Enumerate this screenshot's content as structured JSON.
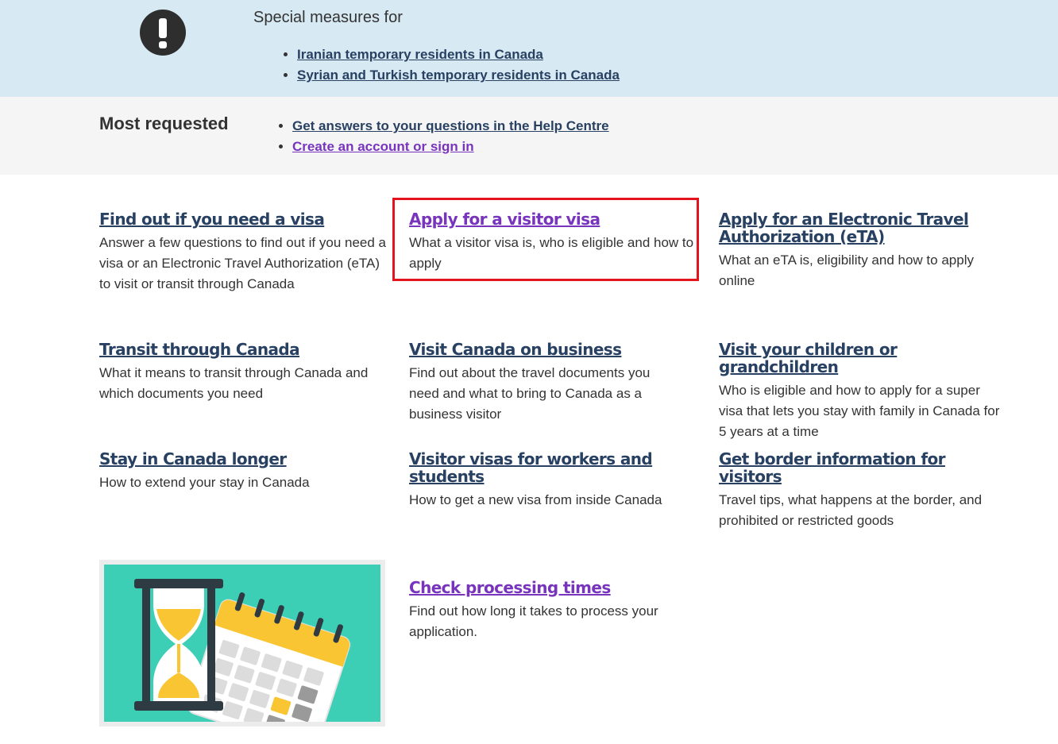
{
  "alert": {
    "title": "Special measures for",
    "links": [
      "Iranian temporary residents in Canada",
      "Syrian and Turkish temporary residents in Canada"
    ],
    "icon": "exclamation-icon"
  },
  "most_requested": {
    "title": "Most requested",
    "links": [
      "Get answers to your questions in the Help Centre",
      "Create an account or sign in"
    ]
  },
  "cards": [
    {
      "title": "Find out if you need a visa",
      "desc": "Answer a few questions to find out if you need a visa or an Electronic Travel Authorization (eTA) to visit or transit through Canada"
    },
    {
      "title": "Apply for a visitor visa",
      "desc": "What a visitor visa is, who is eligible and how to apply"
    },
    {
      "title": "Apply for an Electronic Travel Authorization (eTA)",
      "desc": "What an eTA is, eligibility and how to apply online"
    },
    {
      "title": "Transit through Canada",
      "desc": "What it means to transit through Canada and which documents you need"
    },
    {
      "title": "Visit Canada on business",
      "desc": "Find out about the travel documents you need and what to bring to Canada as a business visitor"
    },
    {
      "title": "Visit your children or grandchildren",
      "desc": "Who is eligible and how to apply for a super visa that lets you stay with family in Canada for 5 years at a time"
    },
    {
      "title": "Stay in Canada longer",
      "desc": "How to extend your stay in Canada"
    },
    {
      "title": "Visitor visas for workers and students",
      "desc": "How to get a new visa from inside Canada"
    },
    {
      "title": "Get border information for visitors",
      "desc": "Travel tips, what happens at the border, and prohibited or restricted goods"
    }
  ],
  "feature": {
    "title": "Check processing times",
    "desc": "Find out how long it takes to process your application.",
    "image": "hourglass-calendar-illustration"
  },
  "colors": {
    "link": "#284162",
    "visited": "#7834bc",
    "highlight": "#e3141e",
    "alert_bg": "#d7e9f3",
    "teal": "#3dcfb6",
    "yellow": "#f9c532"
  }
}
